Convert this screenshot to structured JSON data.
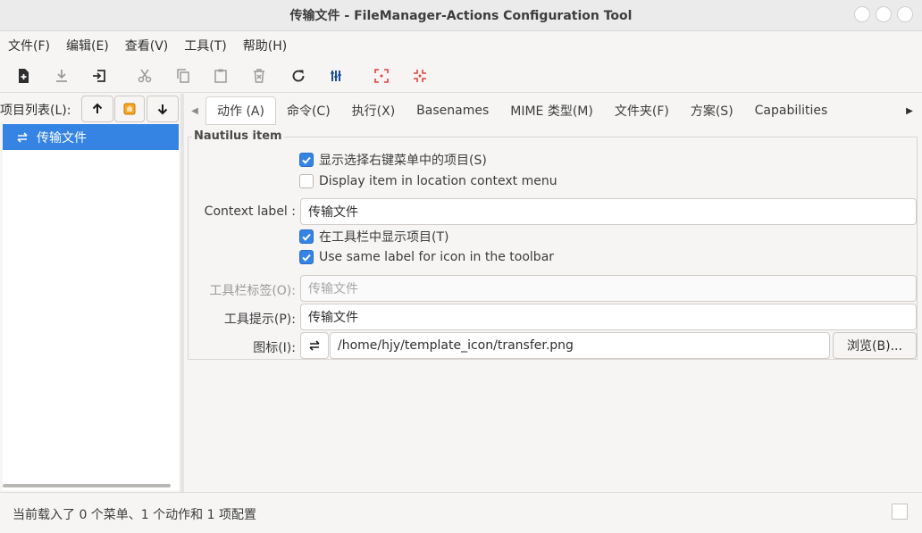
{
  "window": {
    "title": "传输文件 - FileManager-Actions Configuration Tool"
  },
  "menubar": {
    "items": [
      "文件(F)",
      "编辑(E)",
      "查看(V)",
      "工具(T)",
      "帮助(H)"
    ]
  },
  "toolbar": {
    "icons": [
      "new-item-icon",
      "download-icon",
      "import-icon",
      "cut-icon",
      "copy-icon",
      "paste-icon",
      "delete-icon",
      "refresh-icon",
      "columns-icon",
      "expand-icon",
      "collapse-icon"
    ]
  },
  "left": {
    "list_label": "项目列表(L):",
    "tree_items": [
      {
        "label": "传输文件",
        "selected": true,
        "icon": "transfer-arrows-icon"
      }
    ]
  },
  "tabs": {
    "items": [
      "动作 (A)",
      "命令(C)",
      "执行(X)",
      "Basenames",
      "MIME 类型(M)",
      "文件夹(F)",
      "方案(S)",
      "Capabilities"
    ],
    "active_index": 0
  },
  "nautilus": {
    "group_title": "Nautilus item",
    "check_selection_menu": {
      "label": "显示选择右键菜单中的项目(S)",
      "checked": true
    },
    "check_location_menu": {
      "label": "Display item in location context menu",
      "checked": false
    },
    "context_label": {
      "label": "Context label :",
      "value": "传输文件"
    },
    "check_toolbar_show": {
      "label": "在工具栏中显示项目(T)",
      "checked": true
    },
    "check_same_label": {
      "label": "Use same label for icon in the toolbar",
      "checked": true
    },
    "toolbar_label": {
      "label": "工具栏标签(O):",
      "placeholder": "传输文件"
    },
    "tooltip": {
      "label": "工具提示(P):",
      "value": "传输文件"
    },
    "icon": {
      "label": "图标(I):",
      "path": "/home/hjy/template_icon/transfer.png",
      "browse_label": "浏览(B)..."
    }
  },
  "status": {
    "text": "当前载入了 0 个菜单、1 个动作和 1 项配置"
  },
  "colors": {
    "accent": "#3584e4",
    "titlebar": "#ebebeb",
    "window_bg": "#f6f5f4"
  }
}
